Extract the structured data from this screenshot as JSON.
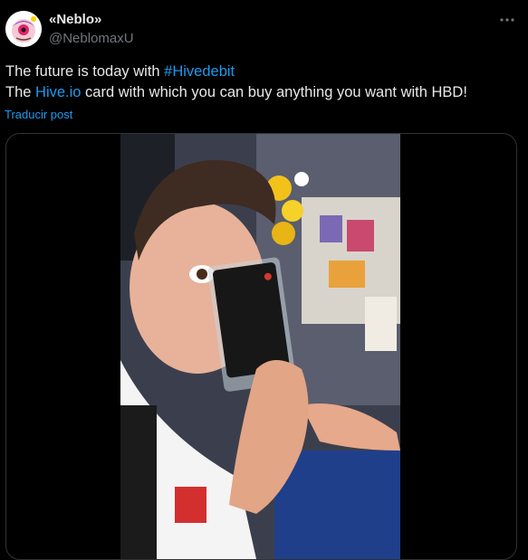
{
  "author": {
    "display_name": "«Neblo»",
    "handle": "@NeblomaxU"
  },
  "tweet": {
    "line1_prefix": "The future is today with ",
    "hashtag": "#Hivedebit",
    "line2_prefix": "The ",
    "link": "Hive.io",
    "line2_suffix": " card with which you can buy anything you want with HBD!",
    "translate_label": "Traducir post"
  },
  "icons": {
    "more": "more-horizontal-icon"
  },
  "colors": {
    "background": "#000000",
    "text": "#e7e9ea",
    "secondary": "#71767b",
    "accent": "#1d9bf0",
    "border": "#2f3336"
  }
}
